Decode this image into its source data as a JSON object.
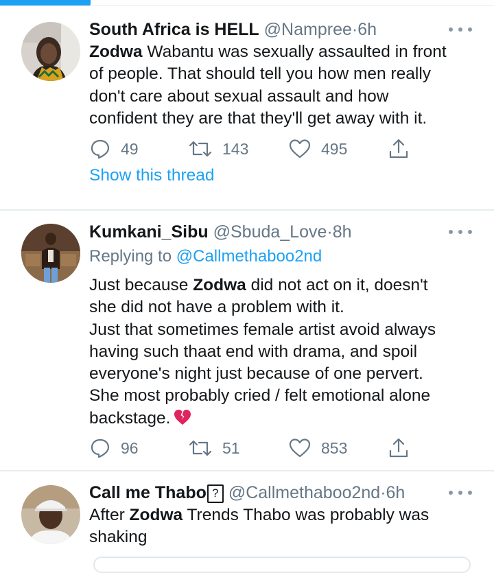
{
  "tweets": [
    {
      "display_name": "South Africa is HELL",
      "handle": "@Nampree",
      "separator": "·",
      "time": "6h",
      "body_lines": [
        [
          {
            "text": "Zodwa",
            "bold": true
          },
          {
            "text": " Wabantu was sexually assaulted in front"
          }
        ],
        [
          {
            "text": "of people. That should tell you how men really"
          }
        ],
        [
          {
            "text": "don't care about sexual assault and how"
          }
        ],
        [
          {
            "text": "confident they are that they'll get away with it."
          }
        ]
      ],
      "actions": {
        "replies": "49",
        "retweets": "143",
        "likes": "495"
      },
      "show_thread": "Show this thread",
      "icons": {
        "reply": "reply-icon",
        "retweet": "retweet-icon",
        "like": "heart-icon",
        "share": "share-icon",
        "more": "more-dots-icon"
      }
    },
    {
      "display_name": "Kumkani_Sibu",
      "handle": "@Sbuda_Love",
      "separator": "·",
      "time": "8h",
      "replying_prefix": "Replying to",
      "replying_to": "@Callmethaboo2nd",
      "body_lines": [
        [
          {
            "text": "Just because "
          },
          {
            "text": "Zodwa",
            "bold": true
          },
          {
            "text": " did not act on it, doesn't"
          }
        ],
        [
          {
            "text": "she did not have a problem with it."
          }
        ],
        [
          {
            "text": "Just that sometimes female artist avoid always"
          }
        ],
        [
          {
            "text": "having such thaat end with drama, and spoil"
          }
        ],
        [
          {
            "text": "everyone's night just because of one pervert."
          }
        ],
        [
          {
            "text": "She most probably cried / felt emotional alone"
          }
        ],
        [
          {
            "text": "backstage.",
            "emoji_after": "broken-heart-icon"
          }
        ]
      ],
      "actions": {
        "replies": "96",
        "retweets": "51",
        "likes": "853"
      }
    },
    {
      "display_name": "Call me Thabo",
      "name_glyph": "?",
      "handle": "@Callmethaboo2nd",
      "separator": "·",
      "time": "6h",
      "body_lines": [
        [
          {
            "text": "After "
          },
          {
            "text": "Zodwa",
            "bold": true
          },
          {
            "text": " Trends Thabo was probably was"
          }
        ],
        [
          {
            "text": "shaking"
          }
        ]
      ]
    }
  ],
  "colors": {
    "accent": "#1da1f2",
    "text": "#14171a",
    "secondary": "#657786",
    "divider": "#e6ecf0"
  }
}
